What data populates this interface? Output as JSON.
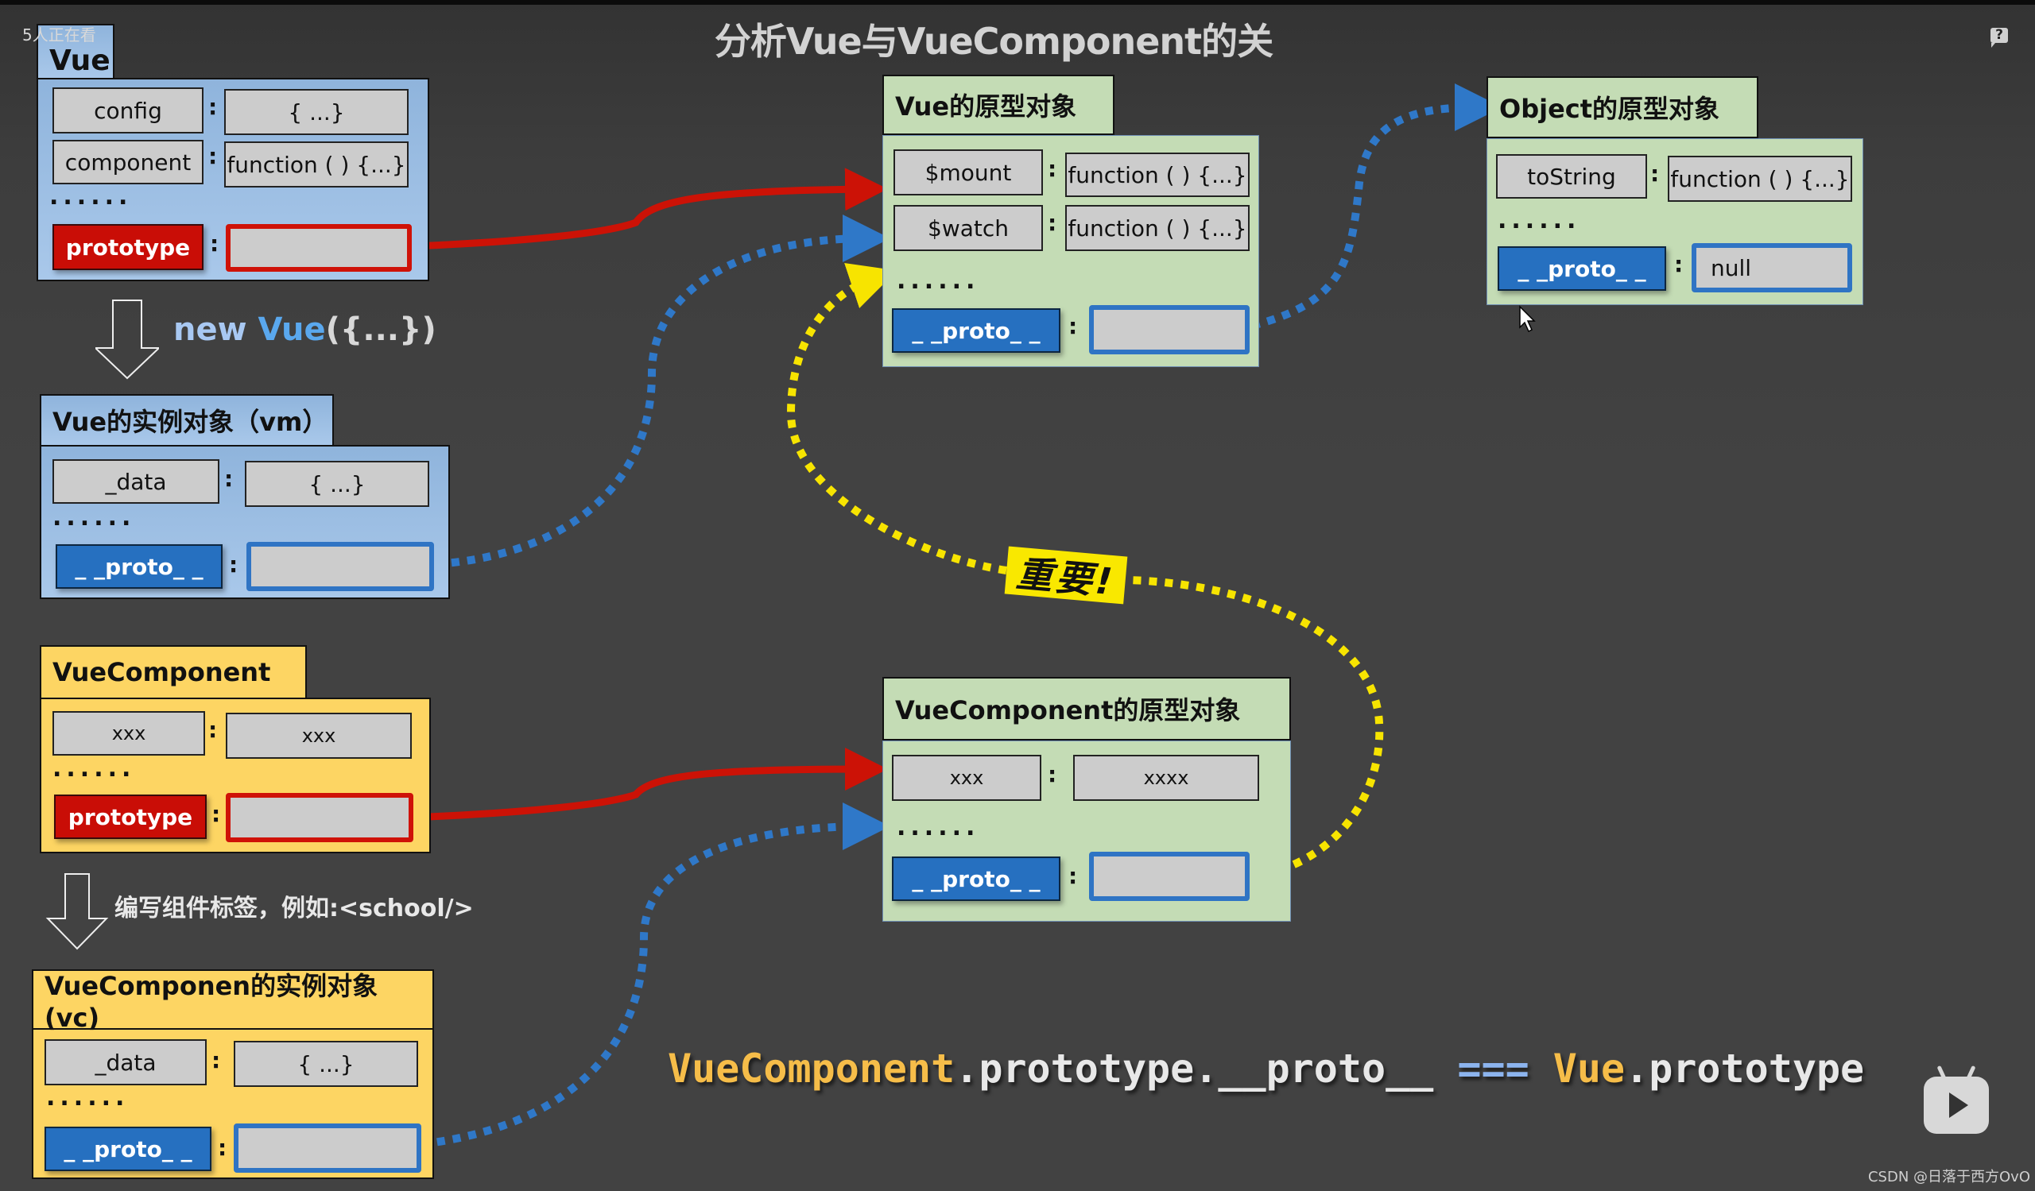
{
  "header": {
    "title": "分析Vue与VueComponent的关系",
    "viewers": "5人正在看",
    "help_icon": "question-bubble-icon"
  },
  "vue": {
    "title": "Vue",
    "rows": [
      {
        "key": "config",
        "value": "{ ...}"
      },
      {
        "key": "component",
        "value": "function ( ) {...}"
      }
    ],
    "ellipsis": "......",
    "prototype_key": "prototype",
    "prototype_value": ""
  },
  "new_vue_caption": {
    "prefix": "new ",
    "name": "Vue",
    "suffix": "({...})"
  },
  "vm": {
    "title": "Vue的实例对象（vm）",
    "rows": [
      {
        "key": "_data",
        "value": "{ ...}"
      }
    ],
    "ellipsis": "......",
    "proto_key": "_ _proto_ _",
    "proto_value": ""
  },
  "vue_component": {
    "title": "VueComponent",
    "rows": [
      {
        "key": "xxx",
        "value": "xxx"
      }
    ],
    "ellipsis": "......",
    "prototype_key": "prototype",
    "prototype_value": ""
  },
  "component_tag_caption": "编写组件标签，例如:<school/>",
  "vc": {
    "title": "VueComponen的实例对象(vc)",
    "rows": [
      {
        "key": "_data",
        "value": "{ ...}"
      }
    ],
    "ellipsis": "......",
    "proto_key": "_ _proto_ _",
    "proto_value": ""
  },
  "vue_prototype": {
    "title": "Vue的原型对象",
    "rows": [
      {
        "key": "$mount",
        "value": "function ( ) {...}"
      },
      {
        "key": "$watch",
        "value": "function ( ) {...}"
      }
    ],
    "ellipsis": "......",
    "proto_key": "_ _proto_ _",
    "proto_value": ""
  },
  "object_prototype": {
    "title": "Object的原型对象",
    "rows": [
      {
        "key": "toString",
        "value": "function ( ) {...}"
      }
    ],
    "ellipsis": "......",
    "proto_key": "_ _proto_ _",
    "proto_value": "null"
  },
  "vue_component_prototype": {
    "title": "VueComponent的原型对象",
    "rows": [
      {
        "key": "xxx",
        "value": "xxxx"
      }
    ],
    "ellipsis": "......",
    "proto_key": "_ _proto_ _",
    "proto_value": ""
  },
  "important_label": "重要!",
  "formula": {
    "part1": "VueComponent",
    "part2": ".prototype.__proto__ ",
    "part3": "===",
    "part4": " Vue",
    "part5": ".prototype"
  },
  "colors": {
    "prototype_arrow": "#cc1206",
    "proto_arrow": "#2f78c8",
    "important_arrow": "#f7e400"
  },
  "watermark": "CSDN @日落于西方OvO",
  "player_icon": "bilibili-tv-icon"
}
